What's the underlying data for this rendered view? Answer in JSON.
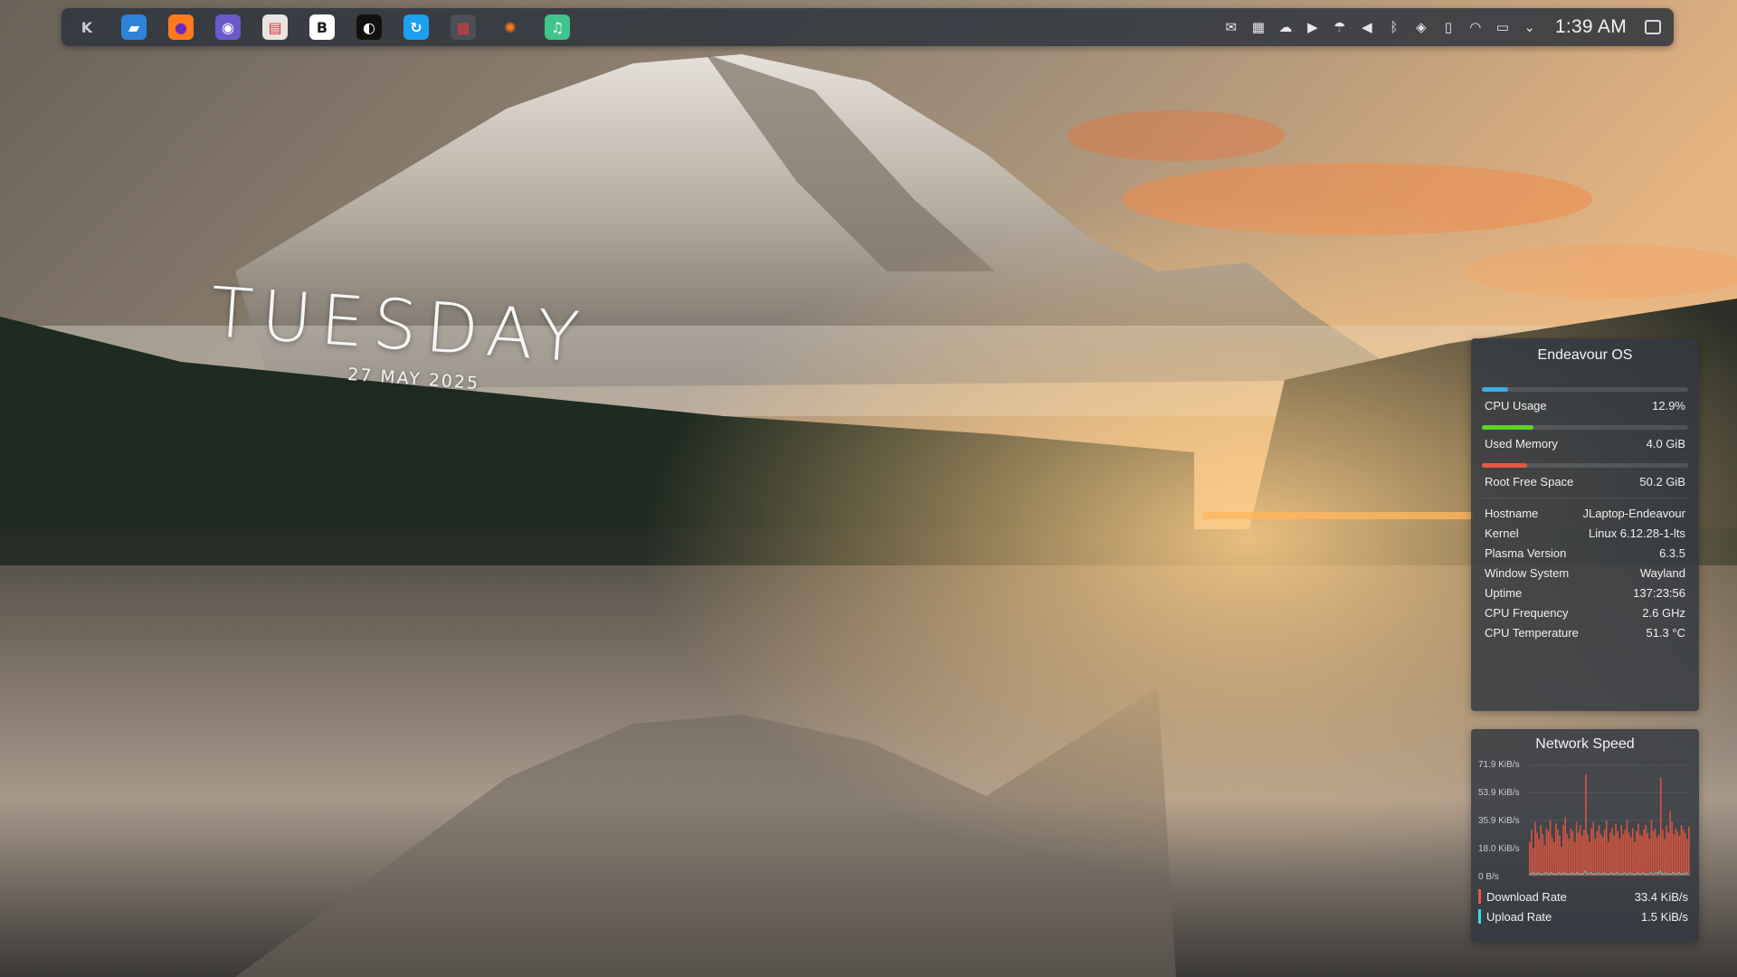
{
  "panel": {
    "apps": [
      {
        "name": "kde-menu-icon",
        "glyph": "K",
        "bg": "transparent",
        "fg": "#c9ccd2"
      },
      {
        "name": "dolphin-file-manager-icon",
        "glyph": "▰",
        "bg": "#2e83d9",
        "fg": "#ffffff"
      },
      {
        "name": "firefox-icon",
        "glyph": "●",
        "bg": "#ff7a1a",
        "fg": "#6b2bb8"
      },
      {
        "name": "thunderbird-icon",
        "glyph": "◉",
        "bg": "#6a59c9",
        "fg": "#ffffff"
      },
      {
        "name": "archive-manager-icon",
        "glyph": "▤",
        "bg": "#e9e4e0",
        "fg": "#d33a3a"
      },
      {
        "name": "bitwarden-icon",
        "glyph": "B",
        "bg": "#ffffff",
        "fg": "#1d1d1d"
      },
      {
        "name": "lutris-icon",
        "glyph": "◐",
        "bg": "#111111",
        "fg": "#ffffff"
      },
      {
        "name": "sync-app-icon",
        "glyph": "↻",
        "bg": "#1ea0f0",
        "fg": "#ffffff"
      },
      {
        "name": "system-monitor-icon",
        "glyph": "▦",
        "bg": "#4a4f58",
        "fg": "#e23a3a"
      },
      {
        "name": "settings-gear-icon",
        "glyph": "✺",
        "bg": "transparent",
        "fg": "#ff7b1c"
      },
      {
        "name": "music-player-icon",
        "glyph": "♫",
        "bg": "#3ec48c",
        "fg": "#ffffff"
      }
    ],
    "tray": [
      {
        "name": "notifications-icon",
        "glyph": "✉"
      },
      {
        "name": "clipboard-icon",
        "glyph": "▦"
      },
      {
        "name": "cloud-sync-icon",
        "glyph": "☁"
      },
      {
        "name": "media-player-icon",
        "glyph": "▶"
      },
      {
        "name": "weather-icon",
        "glyph": "☂"
      },
      {
        "name": "volume-icon",
        "glyph": "◀"
      },
      {
        "name": "bluetooth-icon",
        "glyph": "ᛒ"
      },
      {
        "name": "vpn-shield-icon",
        "glyph": "◈"
      },
      {
        "name": "device-icon",
        "glyph": "▯"
      },
      {
        "name": "wifi-icon",
        "glyph": "◠"
      },
      {
        "name": "battery-icon",
        "glyph": "▭"
      },
      {
        "name": "tray-expand-chevron-icon",
        "glyph": "⌄"
      }
    ],
    "clock": "1:39 AM"
  },
  "date_widget": {
    "day": "TUESDAY",
    "date": "27 MAY 2025"
  },
  "sysinfo": {
    "title": "Endeavour OS",
    "meters": [
      {
        "label": "CPU Usage",
        "value": "12.9%",
        "fill": 0.129,
        "color": "#3daee9"
      },
      {
        "label": "Used Memory",
        "value": "4.0 GiB",
        "fill": 0.25,
        "color": "#5fd12b"
      },
      {
        "label": "Root Free Space",
        "value": "50.2 GiB",
        "fill": 0.22,
        "color": "#e8573f"
      }
    ],
    "info": [
      {
        "label": "Hostname",
        "value": "JLaptop-Endeavour"
      },
      {
        "label": "Kernel",
        "value": "Linux 6.12.28-1-lts"
      },
      {
        "label": "Plasma Version",
        "value": "6.3.5"
      },
      {
        "label": "Window System",
        "value": "Wayland"
      },
      {
        "label": "Uptime",
        "value": "137:23:56"
      },
      {
        "label": "CPU Frequency",
        "value": "2.6 GHz"
      },
      {
        "label": "CPU Temperature",
        "value": "51.3 °C"
      }
    ]
  },
  "network": {
    "title": "Network Speed",
    "axis": [
      "71.9 KiB/s",
      "53.9 KiB/s",
      "35.9 KiB/s",
      "18.0 KiB/s",
      "0 B/s"
    ],
    "download_label": "Download Rate",
    "download_value": "33.4 KiB/s",
    "upload_label": "Upload Rate",
    "upload_value": "1.5 KiB/s",
    "download_color": "#e8573f",
    "upload_color": "#3adbe0",
    "chart_data": {
      "type": "area",
      "ylim": [
        0,
        71.9
      ],
      "download": [
        22,
        30,
        18,
        35,
        28,
        24,
        33,
        27,
        20,
        31,
        29,
        36,
        25,
        22,
        34,
        30,
        26,
        19,
        33,
        38,
        27,
        24,
        31,
        29,
        22,
        35,
        28,
        33,
        26,
        30,
        66,
        27,
        22,
        31,
        35,
        24,
        29,
        33,
        27,
        25,
        30,
        36,
        22,
        28,
        31,
        26,
        34,
        29,
        24,
        33,
        27,
        30,
        36,
        28,
        25,
        31,
        22,
        29,
        34,
        27,
        26,
        30,
        33,
        28,
        24,
        36,
        29,
        31,
        25,
        27,
        64,
        30,
        24,
        33,
        28,
        42,
        35,
        27,
        31,
        29,
        26,
        33,
        30,
        28,
        24,
        32
      ],
      "upload": [
        1,
        1,
        2,
        1,
        1,
        2,
        1,
        1,
        1,
        2,
        1,
        1,
        2,
        1,
        1,
        1,
        2,
        1,
        1,
        2,
        1,
        1,
        1,
        2,
        1,
        1,
        2,
        1,
        1,
        1,
        3,
        1,
        1,
        2,
        1,
        1,
        1,
        2,
        1,
        1,
        2,
        1,
        1,
        1,
        2,
        1,
        1,
        2,
        1,
        1,
        1,
        2,
        1,
        1,
        2,
        1,
        1,
        1,
        2,
        1,
        1,
        2,
        1,
        1,
        1,
        2,
        1,
        1,
        2,
        1,
        3,
        1,
        1,
        2,
        1,
        1,
        1,
        2,
        1,
        1,
        2,
        1,
        1,
        1,
        2,
        1
      ]
    }
  }
}
